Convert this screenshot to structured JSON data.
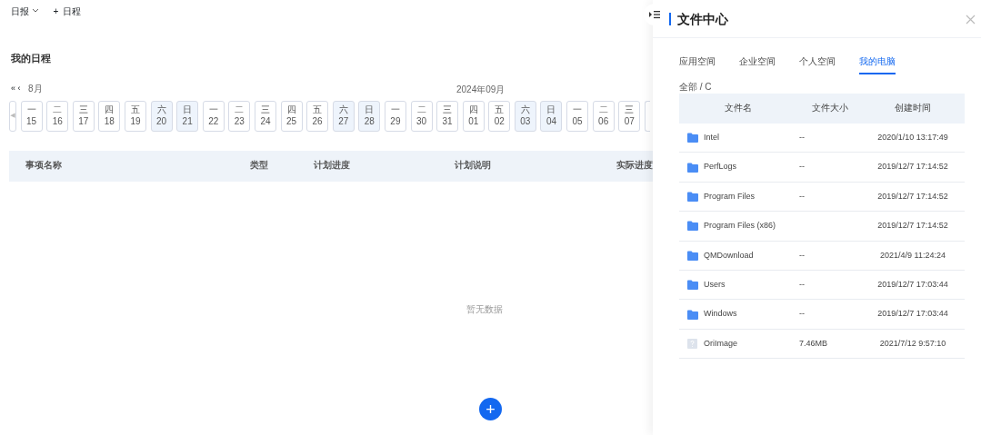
{
  "topbar": {
    "report": "日报",
    "add_icon": "+",
    "add_label": "日程"
  },
  "page_title": "我的日程",
  "calendar": {
    "scroll_left": "◀",
    "prev_year": "«",
    "prev_month": "‹",
    "month": "8月",
    "current": "2024年09月",
    "days": [
      {
        "weekday": "一",
        "date": "15",
        "weekend": false
      },
      {
        "weekday": "二",
        "date": "16",
        "weekend": false
      },
      {
        "weekday": "三",
        "date": "17",
        "weekend": false
      },
      {
        "weekday": "四",
        "date": "18",
        "weekend": false
      },
      {
        "weekday": "五",
        "date": "19",
        "weekend": false
      },
      {
        "weekday": "六",
        "date": "20",
        "weekend": true
      },
      {
        "weekday": "日",
        "date": "21",
        "weekend": true
      },
      {
        "weekday": "一",
        "date": "22",
        "weekend": false
      },
      {
        "weekday": "二",
        "date": "23",
        "weekend": false
      },
      {
        "weekday": "三",
        "date": "24",
        "weekend": false
      },
      {
        "weekday": "四",
        "date": "25",
        "weekend": false
      },
      {
        "weekday": "五",
        "date": "26",
        "weekend": false
      },
      {
        "weekday": "六",
        "date": "27",
        "weekend": true
      },
      {
        "weekday": "日",
        "date": "28",
        "weekend": true
      },
      {
        "weekday": "一",
        "date": "29",
        "weekend": false
      },
      {
        "weekday": "二",
        "date": "30",
        "weekend": false
      },
      {
        "weekday": "三",
        "date": "31",
        "weekend": false
      },
      {
        "weekday": "四",
        "date": "01",
        "weekend": false
      },
      {
        "weekday": "五",
        "date": "02",
        "weekend": false
      },
      {
        "weekday": "六",
        "date": "03",
        "weekend": true
      },
      {
        "weekday": "日",
        "date": "04",
        "weekend": true
      },
      {
        "weekday": "一",
        "date": "05",
        "weekend": false
      },
      {
        "weekday": "二",
        "date": "06",
        "weekend": false
      },
      {
        "weekday": "三",
        "date": "07",
        "weekend": false
      }
    ]
  },
  "table": {
    "columns": [
      "事项名称",
      "类型",
      "计划进度",
      "计划说明",
      "实际进度"
    ],
    "empty": "暂无数据"
  },
  "drawer": {
    "title": "文件中心",
    "tabs": [
      {
        "label": "应用空间",
        "selected": false
      },
      {
        "label": "企业空间",
        "selected": false
      },
      {
        "label": "个人空间",
        "selected": false
      },
      {
        "label": "我的电脑",
        "selected": true
      }
    ],
    "breadcrumb": "全部 / C",
    "columns": [
      "文件名",
      "文件大小",
      "创建时间"
    ],
    "rows": [
      {
        "kind": "folder",
        "name": "Intel",
        "size": "--",
        "created": "2020/1/10 13:17:49"
      },
      {
        "kind": "folder",
        "name": "PerfLogs",
        "size": "--",
        "created": "2019/12/7 17:14:52"
      },
      {
        "kind": "folder",
        "name": "Program Files",
        "size": "--",
        "created": "2019/12/7 17:14:52"
      },
      {
        "kind": "folder",
        "name": "Program Files (x86)",
        "created": "2019/12/7 17:14:52"
      },
      {
        "kind": "folder",
        "name": "QMDownload",
        "size": "--",
        "created": "2021/4/9 11:24:24"
      },
      {
        "kind": "folder",
        "name": "Users",
        "size": "--",
        "created": "2019/12/7 17:03:44"
      },
      {
        "kind": "folder",
        "name": "Windows",
        "size": "--",
        "created": "2019/12/7 17:03:44"
      },
      {
        "kind": "file",
        "name": "OriImage",
        "size": "7.46MB",
        "created": "2021/7/12 9:57:10"
      }
    ]
  }
}
